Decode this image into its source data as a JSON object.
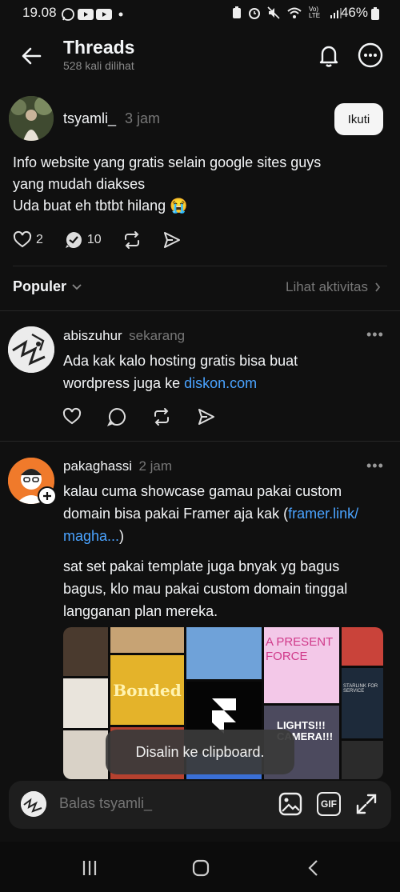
{
  "status_bar": {
    "time": "19.08",
    "battery": "46%",
    "network": "Vo) LTE"
  },
  "header": {
    "title": "Threads",
    "subtitle": "528 kali dilihat"
  },
  "post": {
    "username": "tsyamli_",
    "time": "3 jam",
    "follow_label": "Ikuti",
    "text_lines": [
      "Info website yang gratis selain google sites guys",
      "yang mudah diakses",
      "Uda buat eh tbtbt hilang 😭"
    ],
    "likes": "2",
    "replies": "10"
  },
  "sort": {
    "label": "Populer",
    "activity_link": "Lihat aktivitas"
  },
  "replies": [
    {
      "username": "abiszuhur",
      "time": "sekarang",
      "text_lines": [
        "Ada kak kalo hosting gratis bisa buat"
      ],
      "line2_prefix": "wordpress juga ke ",
      "line2_link": "diskon.com"
    },
    {
      "username": "pakaghassi",
      "time": "2 jam",
      "p1_line1": "kalau cuma showcase gamau pakai custom",
      "p1_line2_prefix": "domain bisa pakai Framer aja kak (",
      "p1_link_a": "framer.link/",
      "p1_link_b": "magha...",
      "p1_line3_suffix": ")",
      "p2_lines": [
        "sat set pakai template juga bnyak yg bagus",
        "bagus, klo mau pakai custom domain tinggal",
        "langganan plan mereka."
      ],
      "image_labels": {
        "bonded": "Bonded",
        "present": "A PRESENT",
        "force": "FORCE",
        "lights": "LIGHTS!!!",
        "camera": "CAMERA!!!",
        "starlink": "STARLINK FOR SERVICE"
      }
    }
  ],
  "toast": "Disalin ke clipboard.",
  "reply_bar": {
    "placeholder": "Balas tsyamli_",
    "gif_label": "GIF"
  },
  "colors": {
    "background": "#101010",
    "link": "#4aa3ff",
    "muted": "#777777"
  }
}
